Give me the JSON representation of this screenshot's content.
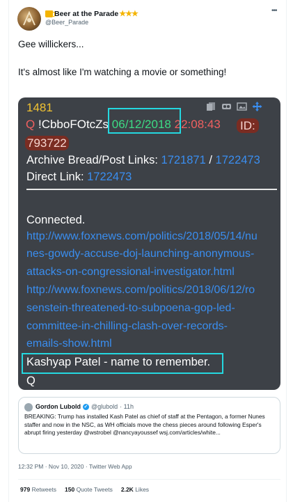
{
  "author": {
    "display_name": "Beer at the Parade",
    "stars": "★★★",
    "handle": "@Beer_Parade",
    "more_label": "•••"
  },
  "tweet": {
    "line1": "Gee willickers...",
    "line2": "It's almost like I'm watching a movie or something!"
  },
  "q_image": {
    "post_number": "1481",
    "q_label": "Q",
    "tripcode": "!CbboFOtcZs",
    "date": "06/12/2018",
    "time": "22:08:43",
    "id_label": "ID:",
    "id_value": "793722",
    "archive_label": "Archive Bread/Post Links:",
    "archive_link1": "1721871",
    "archive_sep": "/",
    "archive_link2": "1722473",
    "direct_label": "Direct Link:",
    "direct_link": "1722473",
    "connected": "Connected.",
    "url_lines": [
      "http://www.foxnews.com/politics/2018/05/14/nu",
      "nes-gowdy-accuse-doj-launching-anonymous-",
      "attacks-on-congressional-investigator.html",
      "http://www.foxnews.com/politics/2018/06/12/ro",
      "senstein-threatened-to-subpoena-gop-led-",
      "committee-in-chilling-clash-over-records-",
      "emails-show.html"
    ],
    "highlight": "Kashyap Patel - name to remember.",
    "signature": "Q",
    "tool_icons": [
      "copy-icon",
      "vr-icon",
      "image-icon",
      "move-icon"
    ]
  },
  "quoted_tweet": {
    "name": "Gordon Lubold",
    "handle": "@glubold",
    "time": "· 11h",
    "body": "BREAKING: Trump has installed Kash Patel as chief of staff at the Pentagon, a former Nunes staffer and now in the NSC, as WH officials move the chess pieces around following Esper's abrupt firing yesterday @wstrobel @nancyayoussef wsj.com/articles/white..."
  },
  "meta": "12:32 PM · Nov 10, 2020 · Twitter Web App",
  "stats": {
    "retweets_count": "979",
    "retweets_label": "Retweets",
    "quotes_count": "150",
    "quotes_label": "Quote Tweets",
    "likes_count": "2.2K",
    "likes_label": "Likes"
  },
  "colors": {
    "q_bg": "#3d4147",
    "highlight_box": "#24d8e0",
    "link": "#3a8ef0",
    "date_green": "#3ddc84",
    "q_red": "#f06060",
    "number_yellow": "#f1c232",
    "twitter_blue": "#1d9bf0"
  }
}
